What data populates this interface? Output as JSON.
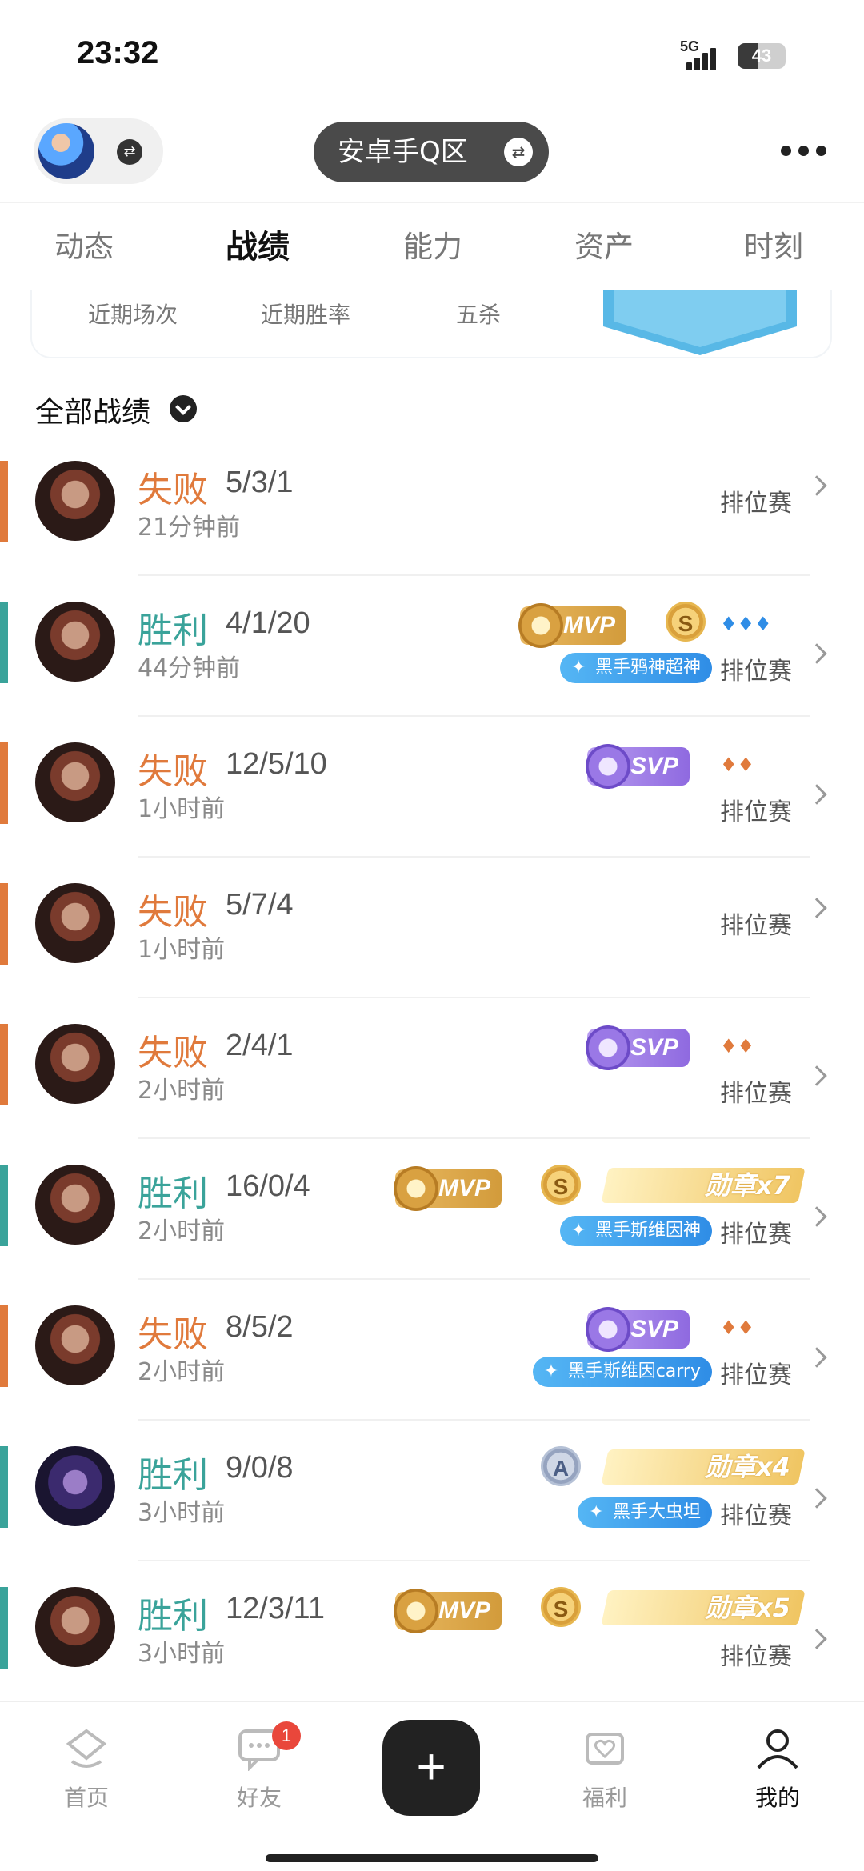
{
  "status": {
    "time": "23:32",
    "network": "5G",
    "battery": "43",
    "battery_level": 0.43
  },
  "header": {
    "server_label": "安卓手Q区"
  },
  "tabs": [
    "动态",
    "战绩",
    "能力",
    "资产",
    "时刻"
  ],
  "active_tab": "战绩",
  "stats": {
    "labels": [
      "近期场次",
      "近期胜率",
      "五杀"
    ]
  },
  "filter": {
    "label": "全部战绩"
  },
  "matches": [
    {
      "result": "失败",
      "kda": "5/3/1",
      "ago": "21分钟前",
      "mode": "排位赛"
    },
    {
      "result": "胜利",
      "kda": "4/1/20",
      "ago": "44分钟前",
      "mode": "排位赛",
      "badge": "MVP",
      "coin": "S",
      "tag": "黑手鸦神超神"
    },
    {
      "result": "失败",
      "kda": "12/5/10",
      "ago": "1小时前",
      "mode": "排位赛",
      "badge": "SVP"
    },
    {
      "result": "失败",
      "kda": "5/7/4",
      "ago": "1小时前",
      "mode": "排位赛"
    },
    {
      "result": "失败",
      "kda": "2/4/1",
      "ago": "2小时前",
      "mode": "排位赛",
      "badge": "SVP"
    },
    {
      "result": "胜利",
      "kda": "16/0/4",
      "ago": "2小时前",
      "mode": "排位赛",
      "badge": "MVP",
      "coin": "S",
      "medal": "勋章x7",
      "tag": "黑手斯维因神"
    },
    {
      "result": "失败",
      "kda": "8/5/2",
      "ago": "2小时前",
      "mode": "排位赛",
      "badge": "SVP",
      "tag": "黑手斯维因carry"
    },
    {
      "result": "胜利",
      "kda": "9/0/8",
      "ago": "3小时前",
      "mode": "排位赛",
      "coin": "A",
      "medal": "勋章x4",
      "tag": "黑手大虫坦"
    },
    {
      "result": "胜利",
      "kda": "12/3/11",
      "ago": "3小时前",
      "mode": "排位赛",
      "badge": "MVP",
      "coin": "S",
      "medal": "勋章x5"
    }
  ],
  "nav": {
    "items": [
      "首页",
      "好友",
      "福利",
      "我的"
    ],
    "friends_badge": "1",
    "active": "我的"
  },
  "colors": {
    "win": "#3aa39a",
    "lose": "#e07a3c",
    "accent": "#2f8de6"
  }
}
